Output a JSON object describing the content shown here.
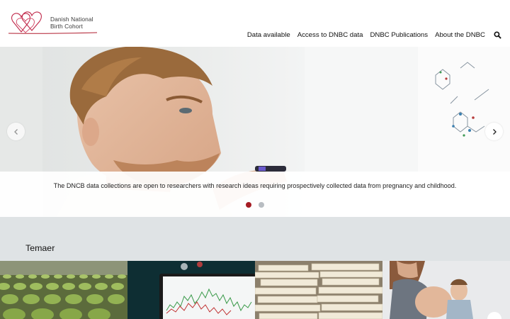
{
  "header": {
    "logo_line1": "Danish National",
    "logo_line2": "Birth Cohort",
    "nav": [
      {
        "label": "Data available"
      },
      {
        "label": "Access to DNBC data"
      },
      {
        "label": "DNBC Publications"
      },
      {
        "label": "About the DNBC"
      }
    ],
    "search_icon": "search-icon"
  },
  "hero": {
    "caption": "The DNCB data collections are open to researchers with research ideas requiring prospectively collected data from pregnancy and childhood.",
    "slides": [
      {
        "active": true
      },
      {
        "active": false
      }
    ],
    "prev_icon": "chevron-left-icon",
    "next_icon": "chevron-right-icon"
  },
  "themes": {
    "title": "Temaer",
    "tiles": [
      {
        "image": "stadium-seats-image"
      },
      {
        "image": "stock-chart-monitor-image"
      },
      {
        "image": "stacked-papers-image"
      },
      {
        "image": "pregnant-woman-child-image"
      }
    ]
  },
  "colors": {
    "brand_red": "#b01c2e",
    "dot_active": "#a51c24",
    "dot_inactive": "#b8bdc2",
    "section_bg": "#dfe3e5"
  }
}
